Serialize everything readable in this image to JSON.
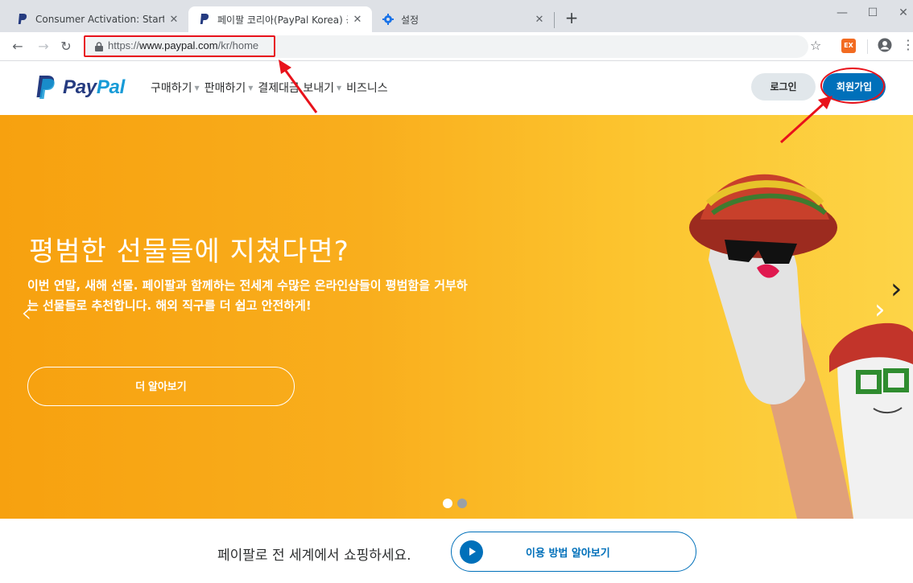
{
  "browser": {
    "tabs": [
      {
        "title": "Consumer Activation: Start Shop",
        "favicon": "paypal-icon",
        "active": false
      },
      {
        "title": "페이팔 코리아(PayPal Korea) 공",
        "favicon": "paypal-icon",
        "active": true
      },
      {
        "title": "설정",
        "favicon": "gear-icon",
        "active": false
      }
    ],
    "new_tab": "+",
    "url": {
      "scheme": "https://",
      "host": "www.paypal.com",
      "path": "/kr/home"
    },
    "extension_label": "EX"
  },
  "header": {
    "logo_word_1": "Pay",
    "logo_word_2": "Pal",
    "nav": [
      {
        "label": "구매하기"
      },
      {
        "label": "판매하기"
      },
      {
        "label": "결제대금 보내기"
      },
      {
        "label": "비즈니스"
      }
    ],
    "login_label": "로그인",
    "signup_label": "회원가입"
  },
  "hero": {
    "headline": "평범한 선물들에 지쳤다면?",
    "body": "이번 연말, 새해 선물. 페이팔과 함께하는 전세계 수많은 온라인샵들이 평범함을 거부하는 선물들로 추천합니다. 해외 직구를 더 쉽고 안전하게!",
    "cta_label": "더 알아보기",
    "slide_count": 2,
    "active_slide": 1
  },
  "bottom": {
    "text": "페이팔로 전 세계에서 쇼핑하세요.",
    "cta_label": "이용 방법 알아보기"
  },
  "colors": {
    "paypal_blue": "#0070ba",
    "paypal_dark": "#253b80",
    "paypal_light": "#179bd7",
    "hero_orange": "#f7a10f",
    "annotation_red": "#e8121b"
  }
}
